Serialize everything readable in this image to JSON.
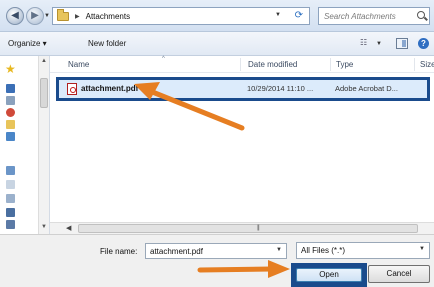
{
  "address_bar": {
    "path_segment": "Attachments",
    "search_placeholder": "Search Attachments"
  },
  "toolbar": {
    "organize_label": "Organize ▾",
    "new_folder_label": "New folder"
  },
  "columns": {
    "name": "Name",
    "date_modified": "Date modified",
    "type": "Type",
    "size": "Size"
  },
  "files": [
    {
      "name": "attachment.pdf",
      "date_modified": "10/29/2014 11:10 ...",
      "type": "Adobe Acrobat D..."
    }
  ],
  "bottom": {
    "file_name_label": "File name:",
    "file_name_value": "attachment.pdf",
    "filter_value": "All Files (*.*)",
    "open_label": "Open",
    "cancel_label": "Cancel"
  },
  "icons": {
    "back": "back-arrow-icon",
    "forward": "forward-arrow-icon",
    "folder": "folder-icon",
    "refresh": "refresh-icon",
    "search": "search-icon",
    "views": "views-icon",
    "preview_pane": "preview-pane-icon",
    "help": "help-icon",
    "favorites": "star-icon",
    "pdf": "pdf-file-icon"
  },
  "colors": {
    "highlight_border": "#1a4b8c",
    "selection_fill": "#dcebfb",
    "arrow": "#e67e22"
  }
}
